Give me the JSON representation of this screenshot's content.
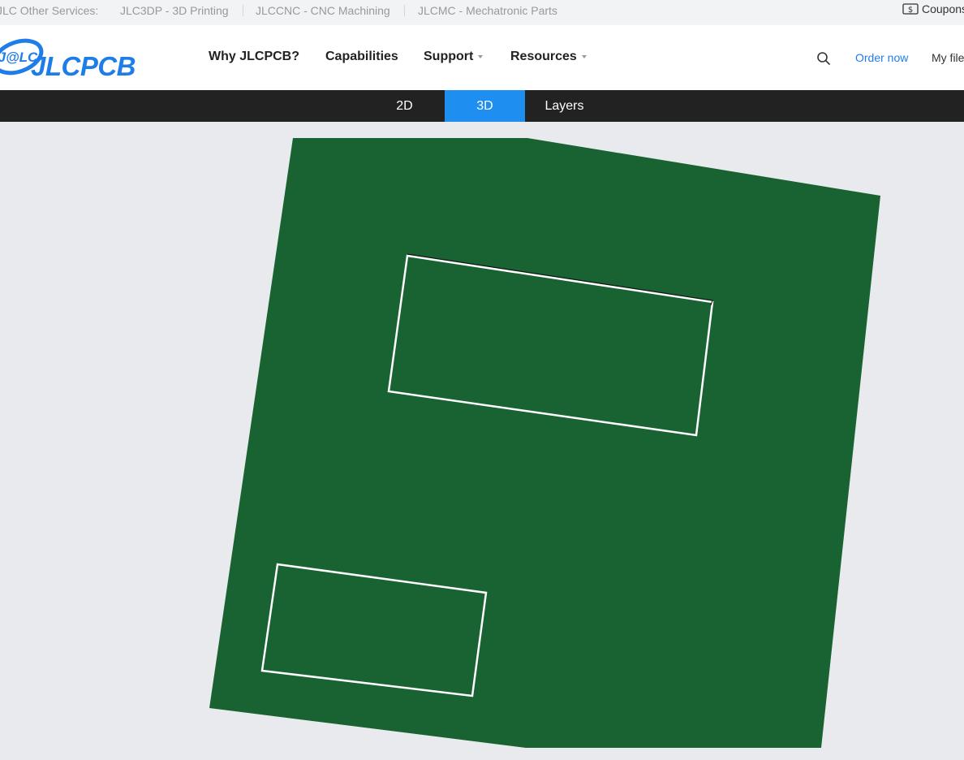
{
  "topbar": {
    "label": "JLC Other Services:",
    "services": [
      "JLC3DP - 3D Printing",
      "JLCCNC - CNC Machining",
      "JLCMC - Mechatronic Parts"
    ],
    "coupons": "Coupons"
  },
  "header": {
    "logo_badge": "J@LC",
    "logo_text": "JLCPCB",
    "nav": [
      {
        "label": "Why JLCPCB?"
      },
      {
        "label": "Capabilities"
      },
      {
        "label": "Support"
      },
      {
        "label": "Resources"
      }
    ],
    "order_now": "Order now",
    "my_file": "My file"
  },
  "viewbar": {
    "tabs": [
      "2D",
      "3D",
      "Layers"
    ],
    "active_tab": "3D"
  },
  "colors": {
    "brand": "#1f7de8",
    "board": "#186331",
    "viewer_bg": "#e9eaed",
    "active_tab": "#1f8ef1"
  },
  "icons": [
    "search-icon",
    "coupon-icon",
    "jlc-logo-icon"
  ]
}
